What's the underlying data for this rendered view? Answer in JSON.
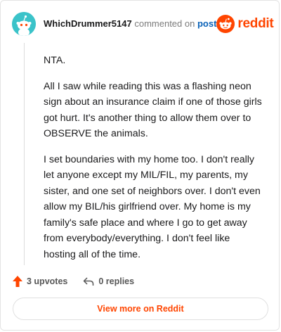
{
  "header": {
    "username": "WhichDrummer5147",
    "action_text": "commented on",
    "post_link": "post",
    "brand": "reddit"
  },
  "comment": {
    "paragraphs": [
      "NTA.",
      "All I saw while reading this was a flashing neon sign about an insurance claim if one of those girls got hurt. It's another thing to allow them over to OBSERVE the animals.",
      "I set boundaries with my home too. I don't really let anyone except my MIL/FIL, my parents, my sister, and one set of neighbors over. I don't even allow my BIL/his girlfriend over. My home is my family's safe place and where I go to get away from everybody/everything. I don't feel like hosting all of the time."
    ]
  },
  "actions": {
    "upvotes": "3 upvotes",
    "replies": "0 replies"
  },
  "footer": {
    "view_more": "View more on Reddit"
  },
  "colors": {
    "brand": "#ff4500",
    "link": "#0a62b8",
    "avatar_bg": "#3bc3c9"
  },
  "icons": [
    "snoo-avatar-icon",
    "reddit-logo-icon",
    "upvote-arrow-icon",
    "reply-arrow-icon"
  ]
}
